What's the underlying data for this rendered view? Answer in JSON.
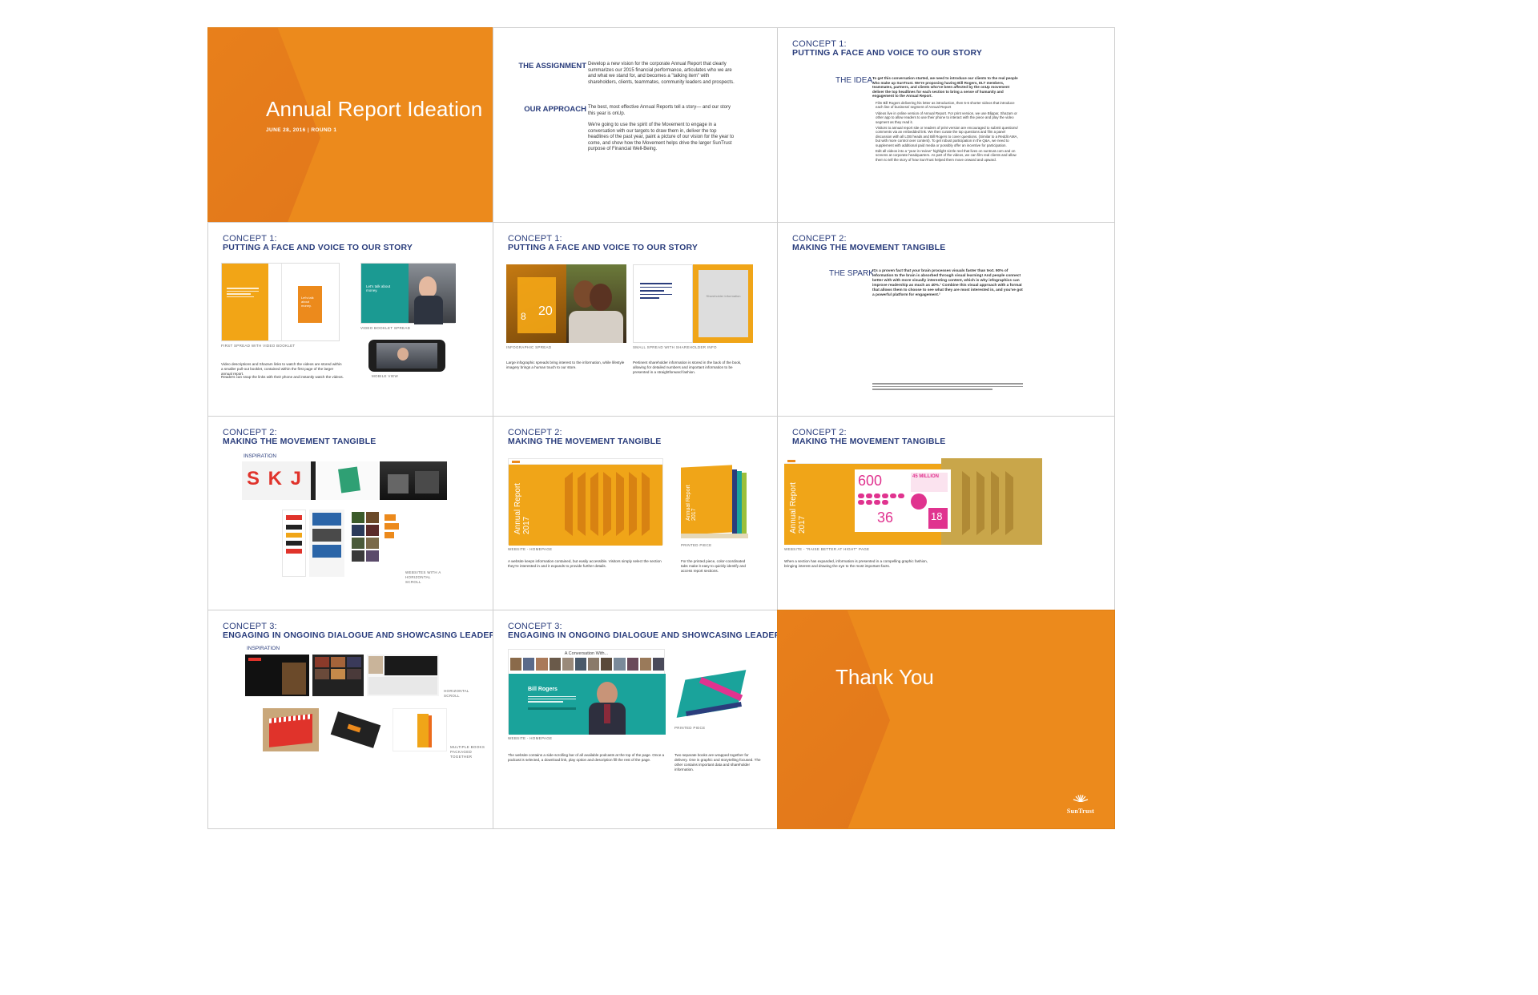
{
  "colors": {
    "orange": "#ec8a1c",
    "navy": "#2a3d7c",
    "teal": "#1aa39b",
    "pink": "#e0338f",
    "gold": "#f0a518"
  },
  "logo": "SunTrust",
  "slide1": {
    "title": "Annual Report Ideation",
    "date": "JUNE 28, 2016",
    "round": "ROUND 1"
  },
  "slide2": {
    "h1": "THE ASSIGNMENT",
    "p1": "Develop a new vision for the corporate Annual Report that clearly summarizes our 2015 financial performance, articulates who we are and what we stand for, and becomes a \"talking item\" with shareholders, clients, teammates, community leaders and prospects.",
    "h2": "OUR APPROACH",
    "p2a": "The best, most effective Annual Reports tell a story— and our story this year is onUp.",
    "p2b": "We're going to use the spirit of the Movement to engage in a conversation with our targets to draw them in, deliver the top headlines of the past year, paint a picture of our vision for the year to come, and show how the Movement helps drive the larger SunTrust purpose of Financial Well-Being."
  },
  "c1": {
    "label": "CONCEPT 1:",
    "title": "PUTTING A FACE AND VOICE TO OUR STORY"
  },
  "c2": {
    "label": "CONCEPT 2:",
    "title": "MAKING THE MOVEMENT TANGIBLE"
  },
  "c3": {
    "label": "CONCEPT 3:",
    "title": "ENGAGING IN ONGOING DIALOGUE AND SHOWCASING LEADERSHIP"
  },
  "slide3": {
    "idea": "THE IDEA:",
    "intro": "To get this conversation started, we need to introduce our clients to the real people who make up SunTrust. We're proposing having Bill Rogers, ELT members, teammates, partners, and clients who've been affected by the onUp movement deliver the top headlines for each section to bring a sense of humanity and engagement to the Annual Report.",
    "bullets": [
      "Film Bill Rogers delivering his letter as introduction, then 5-6 shorter videos that introduce each line of business/ segment of Annual Report",
      "Videos live in online version of Annual Report. For print version, we use Blippar, Shazam or other app to allow readers to use their phone to interact with the piece and play the video segment as they read it.",
      "Visitors to annual report site or readers of print version are encouraged to submit questions/ comments via an embedded link. We then curate the top questions and film a panel discussion with all LOB heads and Bill Rogers to cover questions. (Similar to a Reddit AMA, but with more control over content). To get robust participation in the Q&A, we need to supplement with additional paid media or possibly offer an incentive for participation.",
      "Edit all videos into a \"year in review\" highlight sizzle reel that lives on suntrust.com and on screens at corporate headquarters. As part of the videos, we can film real clients and allow them to tell the story of how SunTrust helped them move onward and upward."
    ]
  },
  "slide4": {
    "cap1": "FIRST SPREAD WITH VIDEO BOOKLET",
    "cap2": "VIDEO BOOKLET SPREAD",
    "cap3": "MOBILE VIEW",
    "booklet_tagline": "Let's talk about money.",
    "spread_text": "Let's talk about money.",
    "body1": "Video descriptions and Shazam links to watch the videos are stored within a smaller pull-out booklet, contained within the first page of the larger annual report.",
    "body2": "Readers can snap the links with their phone and instantly watch the videos."
  },
  "slide5": {
    "cap1": "INFOGRAPHIC SPREAD",
    "cap2": "SMALL SPREAD WITH SHAREHOLDER INFO",
    "info_num": "20",
    "info_num2": "8",
    "placeholder": "Shareholder Information",
    "body1": "Large infographic spreads bring interest to the information, while lifestyle imagery brings a human touch to our store.",
    "body2": "Pertinent shareholder information is stored in the back of the book, allowing for detailed numbers and important information to be presented in a straightforward fashion."
  },
  "slide6": {
    "spark": "THE SPARK:",
    "text": "It's a proven fact that your brain processes visuals faster than text. 90% of information to the brain is absorbed through visual learning! And people connect better with with more visually interesting content, which is why infographics can improve readership as much as 40%.¹ Combine this visual approach with a format that allows them to choose to see what they are most interested in, and you've got a powerful platform for engagement.²"
  },
  "slide7": {
    "inspiration": "INSPIRATION",
    "letters": "S K J",
    "cap": "WEBSITES WITH A HORIZONTAL SCROLL"
  },
  "slide8": {
    "report": "Annual Report 2017",
    "cap1": "WEBSITE - HOMEPAGE",
    "cap2": "PRINTED PIECE",
    "body1": "A website keeps information contained, but easily accessible. Visitors simply select the section they're interested in and it expands to provide further details.",
    "body2": "For the printed piece, color-coordinated tabs make it easy to quickly identify and access report sections."
  },
  "slide9": {
    "report": "Annual Report 2017",
    "n1": "600",
    "n2": "36",
    "n3": "18",
    "million": "45 MILLION",
    "cap": "WEBSITE - \"RAISE BETTER AT HIGHT\" PAGE",
    "body": "When a section has expanded, information is presented in a compelling graphic fashion, bringing interest and drawing the eye to the most important facts."
  },
  "slide10": {
    "inspiration": "INSPIRATION",
    "cap1": "HORIZONTAL SCROLL",
    "cap2": "MULTIPLE BOOKS PACKAGED TOGETHER"
  },
  "slide11": {
    "conv": "A Conversation With...",
    "name": "Bill Rogers",
    "cap1": "WEBSITE - HOMEPAGE",
    "cap2": "PRINTED PIECE",
    "body1": "The website contains a side-scrolling bar of all available podcasts at the top of the page. Once a podcast is selected, a download link, play option and description fill the rest of the page.",
    "body2": "Two separate books are wrapped together for delivery. One is graphic and storytelling focused. The other contains important data and shareholder information."
  },
  "slide12": {
    "title": "Thank You"
  }
}
